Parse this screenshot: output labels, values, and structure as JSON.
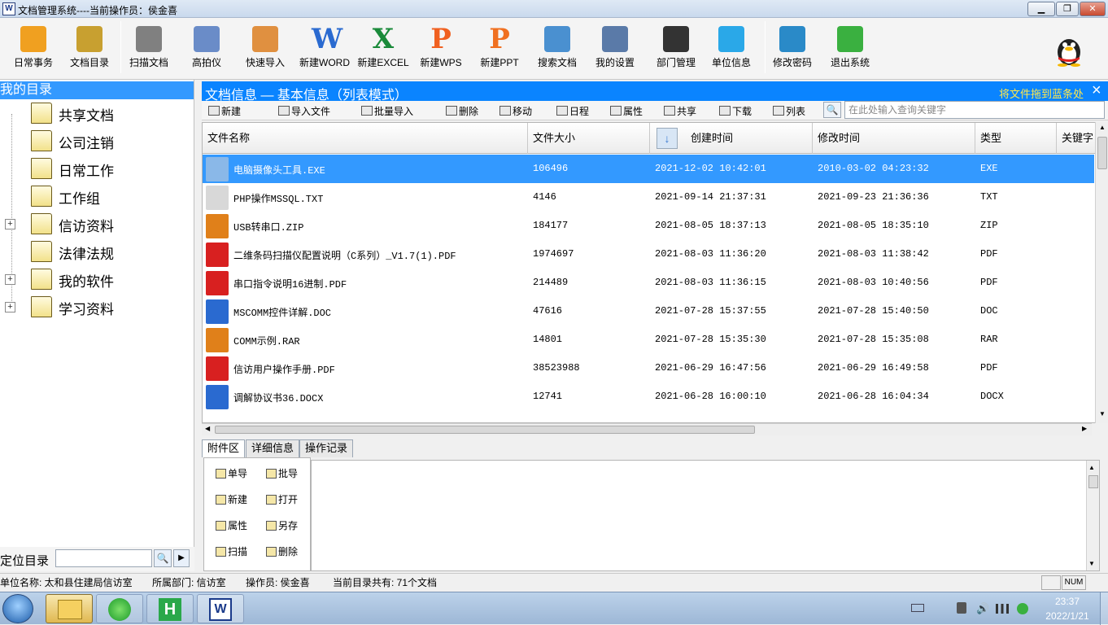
{
  "window": {
    "title": "文档管理系统----当前操作员：侯金喜",
    "app_icon_text": "W"
  },
  "toolbar": {
    "items": [
      {
        "label": "日常事务",
        "icon": "home-icon",
        "color": "#f0a020"
      },
      {
        "label": "文档目录",
        "icon": "cabinet-icon",
        "color": "#c8a030"
      },
      {
        "label": "扫描文档",
        "icon": "scanner-icon",
        "color": "#808080"
      },
      {
        "label": "高拍仪",
        "icon": "camera-icon",
        "color": "#6a8cc8"
      },
      {
        "label": "快速导入",
        "icon": "import-icon",
        "color": "#e09040"
      },
      {
        "label": "新建WORD",
        "icon": "word-icon",
        "color": "#2a6ad0",
        "glyph": "W"
      },
      {
        "label": "新建EXCEL",
        "icon": "excel-icon",
        "color": "#1a8a3a",
        "glyph": "X"
      },
      {
        "label": "新建WPS",
        "icon": "wps-icon",
        "color": "#f06020",
        "glyph": "P"
      },
      {
        "label": "新建PPT",
        "icon": "ppt-icon",
        "color": "#f07020",
        "glyph": "P"
      },
      {
        "label": "搜索文档",
        "icon": "search-doc-icon",
        "color": "#4a90d0"
      },
      {
        "label": "我的设置",
        "icon": "settings-icon",
        "color": "#5a7aa8"
      },
      {
        "label": "部门管理",
        "icon": "department-icon",
        "color": "#333333"
      },
      {
        "label": "单位信息",
        "icon": "unit-info-icon",
        "color": "#2aa8e8"
      },
      {
        "label": "修改密码",
        "icon": "key-icon",
        "color": "#2a8ac8"
      },
      {
        "label": "退出系统",
        "icon": "exit-icon",
        "color": "#3ab040"
      }
    ]
  },
  "left": {
    "header": "我的目录",
    "tree": [
      {
        "label": "共享文档",
        "expandable": false
      },
      {
        "label": "公司注销",
        "expandable": false
      },
      {
        "label": "日常工作",
        "expandable": false
      },
      {
        "label": "工作组",
        "expandable": false
      },
      {
        "label": "信访资料",
        "expandable": true
      },
      {
        "label": "法律法规",
        "expandable": false
      },
      {
        "label": "我的软件",
        "expandable": true
      },
      {
        "label": "学习资料",
        "expandable": true
      }
    ],
    "locate_label": "定位目录",
    "locate_value": ""
  },
  "main": {
    "title": "文档信息 — 基本信息（列表模式）",
    "drag_hint": "将文件拖到蓝条处",
    "close": "×",
    "subtoolbar": [
      "新建",
      "导入文件",
      "批量导入",
      "删除",
      "移动",
      "日程",
      "属性",
      "共享",
      "下载",
      "列表"
    ],
    "search_placeholder": "在此处输入查询关键字",
    "columns": [
      "文件名称",
      "文件大小",
      "创建时间",
      "修改时间",
      "类型",
      "关键字"
    ],
    "rows": [
      {
        "name": "电脑摄像头工具.EXE",
        "size": "106496",
        "created": "2021-12-02 10:42:01",
        "modified": "2010-03-02 04:23:32",
        "type": "EXE",
        "icon": "exe-icon"
      },
      {
        "name": "PHP操作MSSQL.TXT",
        "size": "4146",
        "created": "2021-09-14 21:37:31",
        "modified": "2021-09-23 21:36:36",
        "type": "TXT",
        "icon": "txt-icon"
      },
      {
        "name": "USB转串口.ZIP",
        "size": "184177",
        "created": "2021-08-05 18:37:13",
        "modified": "2021-08-05 18:35:10",
        "type": "ZIP",
        "icon": "zip-icon"
      },
      {
        "name": "二维条码扫描仪配置说明（C系列）_V1.7(1).PDF",
        "size": "1974697",
        "created": "2021-08-03 11:36:20",
        "modified": "2021-08-03 11:38:42",
        "type": "PDF",
        "icon": "pdf-icon"
      },
      {
        "name": "串口指令说明16进制.PDF",
        "size": "214489",
        "created": "2021-08-03 11:36:15",
        "modified": "2021-08-03 10:40:56",
        "type": "PDF",
        "icon": "pdf-icon"
      },
      {
        "name": "MSCOMM控件详解.DOC",
        "size": "47616",
        "created": "2021-07-28 15:37:55",
        "modified": "2021-07-28 15:40:50",
        "type": "DOC",
        "icon": "doc-icon"
      },
      {
        "name": "COMM示例.RAR",
        "size": "14801",
        "created": "2021-07-28 15:35:30",
        "modified": "2021-07-28 15:35:08",
        "type": "RAR",
        "icon": "rar-icon"
      },
      {
        "name": "信访用户操作手册.PDF",
        "size": "38523988",
        "created": "2021-06-29 16:47:56",
        "modified": "2021-06-29 16:49:58",
        "type": "PDF",
        "icon": "pdf-icon"
      },
      {
        "name": "调解协议书36.DOCX",
        "size": "12741",
        "created": "2021-06-28 16:00:10",
        "modified": "2021-06-28 16:04:34",
        "type": "DOCX",
        "icon": "doc-icon"
      }
    ],
    "tabs": [
      "附件区",
      "详细信息",
      "操作记录"
    ],
    "attach_buttons": [
      "单导",
      "批导",
      "新建",
      "打开",
      "属性",
      "另存",
      "扫描",
      "删除"
    ]
  },
  "status": {
    "unit": "单位名称:  太和县住建局信访室",
    "dept": "所属部门: 信访室",
    "operator": "操作员:  侯金喜",
    "count": "当前目录共有: 71个文档",
    "num": "NUM"
  },
  "taskbar": {
    "time": "23:37",
    "date": "2022/1/21"
  }
}
